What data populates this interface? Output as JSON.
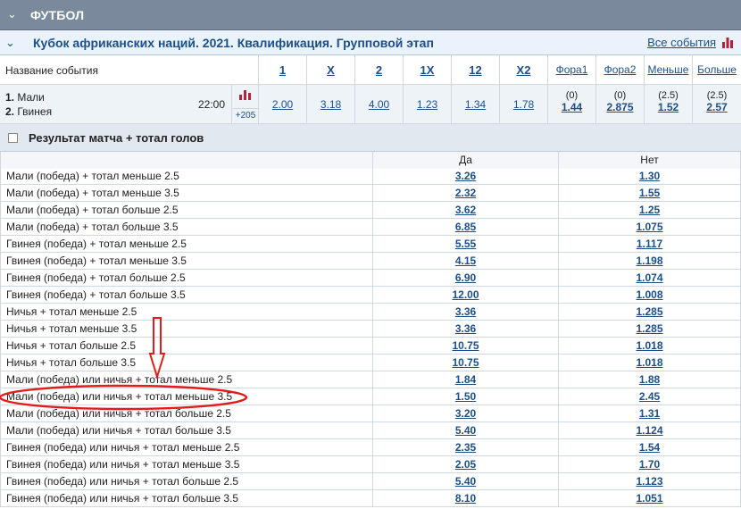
{
  "sport": {
    "title": "ФУТБОЛ"
  },
  "league": {
    "title": "Кубок африканских наций. 2021. Квалификация. Групповой этап",
    "all_events": "Все события"
  },
  "header": {
    "event_name": "Название события",
    "cols": [
      "1",
      "X",
      "2",
      "1X",
      "12",
      "X2",
      "Фора1",
      "Фора2",
      "Меньше",
      "Больше"
    ]
  },
  "match": {
    "team1_num": "1.",
    "team1": "Мали",
    "team2_num": "2.",
    "team2": "Гвинея",
    "time": "22:00",
    "more": "+205",
    "odds": [
      "2.00",
      "3.18",
      "4.00",
      "1.23",
      "1.34",
      "1.78"
    ],
    "fora1": {
      "param": "(0)",
      "value": "1.44"
    },
    "fora2": {
      "param": "(0)",
      "value": "2.875"
    },
    "under": {
      "param": "(2.5)",
      "value": "1.52"
    },
    "over": {
      "param": "(2.5)",
      "value": "2.57"
    }
  },
  "market": {
    "title": "Результат матча + тотал голов",
    "yes": "Да",
    "no": "Нет",
    "rows": [
      {
        "name": "Мали (победа) + тотал меньше 2.5",
        "yes": "3.26",
        "no": "1.30"
      },
      {
        "name": "Мали (победа) + тотал меньше 3.5",
        "yes": "2.32",
        "no": "1.55"
      },
      {
        "name": "Мали (победа) + тотал больше 2.5",
        "yes": "3.62",
        "no": "1.25"
      },
      {
        "name": "Мали (победа) + тотал больше 3.5",
        "yes": "6.85",
        "no": "1.075"
      },
      {
        "name": "Гвинея (победа) + тотал меньше 2.5",
        "yes": "5.55",
        "no": "1.117"
      },
      {
        "name": "Гвинея (победа) + тотал меньше 3.5",
        "yes": "4.15",
        "no": "1.198"
      },
      {
        "name": "Гвинея (победа) + тотал больше 2.5",
        "yes": "6.90",
        "no": "1.074"
      },
      {
        "name": "Гвинея (победа) + тотал больше 3.5",
        "yes": "12.00",
        "no": "1.008"
      },
      {
        "name": "Ничья + тотал меньше 2.5",
        "yes": "3.36",
        "no": "1.285"
      },
      {
        "name": "Ничья + тотал меньше 3.5",
        "yes": "3.36",
        "no": "1.285"
      },
      {
        "name": "Ничья + тотал больше 2.5",
        "yes": "10.75",
        "no": "1.018"
      },
      {
        "name": "Ничья + тотал больше 3.5",
        "yes": "10.75",
        "no": "1.018"
      },
      {
        "name": "Мали (победа) или ничья + тотал меньше 2.5",
        "yes": "1.84",
        "no": "1.88"
      },
      {
        "name": "Мали (победа) или ничья + тотал меньше 3.5",
        "yes": "1.50",
        "no": "2.45"
      },
      {
        "name": "Мали (победа) или ничья + тотал больше 2.5",
        "yes": "3.20",
        "no": "1.31"
      },
      {
        "name": "Мали (победа) или ничья + тотал больше 3.5",
        "yes": "5.40",
        "no": "1.124"
      },
      {
        "name": "Гвинея (победа) или ничья + тотал меньше 2.5",
        "yes": "2.35",
        "no": "1.54"
      },
      {
        "name": "Гвинея (победа) или ничья + тотал меньше 3.5",
        "yes": "2.05",
        "no": "1.70"
      },
      {
        "name": "Гвинея (победа) или ничья + тотал больше 2.5",
        "yes": "5.40",
        "no": "1.123"
      },
      {
        "name": "Гвинея (победа) или ничья + тотал больше 3.5",
        "yes": "8.10",
        "no": "1.051"
      }
    ]
  },
  "colors": {
    "accent": "#1b4f8a",
    "annotation": "#e31b1b",
    "sport_bar": "#7a8a9c"
  },
  "icons": {
    "sport_toggle": "chevron-down-icon",
    "league_toggle": "chevron-down-icon",
    "stats": "bar-chart-icon"
  }
}
